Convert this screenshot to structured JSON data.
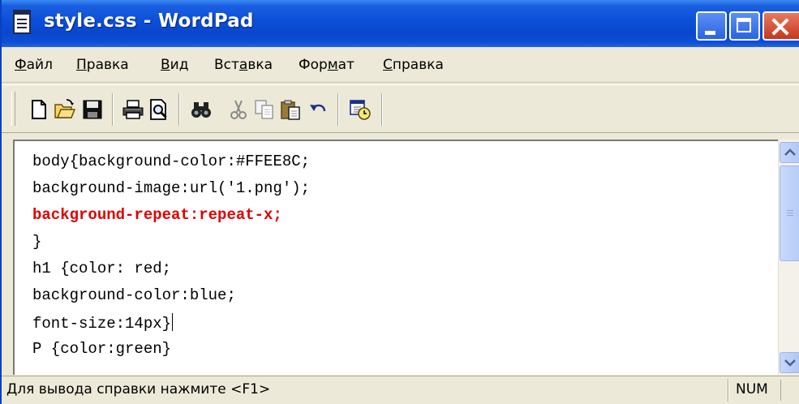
{
  "window": {
    "title": "style.css - WordPad",
    "icon": "wordpad-document-icon"
  },
  "menu": {
    "items": [
      {
        "pre": "",
        "accel": "Ф",
        "post": "айл"
      },
      {
        "pre": "",
        "accel": "П",
        "post": "равка"
      },
      {
        "pre": "",
        "accel": "В",
        "post": "ид"
      },
      {
        "pre": "Вст",
        "accel": "а",
        "post": "вка"
      },
      {
        "pre": "Фор",
        "accel": "м",
        "post": "ат"
      },
      {
        "pre": "",
        "accel": "С",
        "post": "правка"
      }
    ]
  },
  "toolbar": {
    "buttons": [
      "new-icon",
      "open-icon",
      "save-icon",
      "print-icon",
      "print-preview-icon",
      "find-icon",
      "cut-icon",
      "copy-icon",
      "paste-icon",
      "undo-icon",
      "date-time-icon"
    ]
  },
  "editor": {
    "lines": [
      "body{background-color:#FFEE8C;",
      "background-image:url('1.png');",
      "background-repeat:repeat-x;",
      "}",
      "h1 {color: red;",
      "background-color:blue;",
      "font-size:14px}",
      "P {color:green}"
    ],
    "highlight_color": "#e00000"
  },
  "statusbar": {
    "help_text": "Для вывода справки нажмите <F1>",
    "num_indicator": "NUM"
  }
}
